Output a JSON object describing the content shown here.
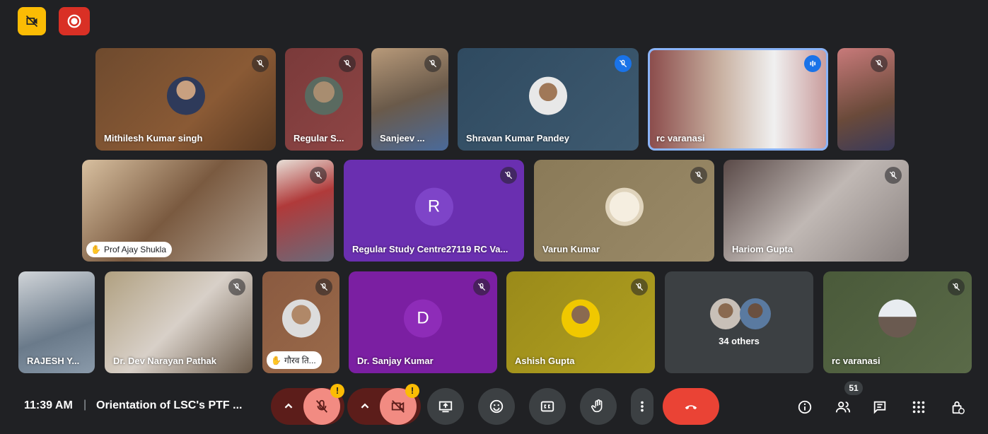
{
  "top_badges": {
    "recording_icon": "record-icon",
    "no_camera_icon": "camera-off-icon"
  },
  "participants_row1": [
    {
      "name": "Mithilesh Kumar singh",
      "muted": true
    },
    {
      "name": "Regular S...",
      "muted": true
    },
    {
      "name": "Sanjeev ...",
      "muted": true
    },
    {
      "name": "Shravan Kumar Pandey",
      "muted": true
    },
    {
      "name": "rc varanasi",
      "speaking": true
    },
    {
      "name": "",
      "muted": true
    }
  ],
  "participants_row2": [
    {
      "name": "Prof Ajay Shukla",
      "hand_raised": true
    },
    {
      "name": "",
      "muted": true
    },
    {
      "name": "Regular Study Centre27119 RC Va...",
      "initial": "R",
      "muted": true
    },
    {
      "name": "Varun Kumar",
      "muted": true
    },
    {
      "name": "Hariom Gupta",
      "muted": true
    }
  ],
  "participants_row3": [
    {
      "name": "RAJESH Y..."
    },
    {
      "name": "Dr. Dev Narayan Pathak",
      "muted": true
    },
    {
      "name": "गौरव ति...",
      "hand_raised": true,
      "muted": true
    },
    {
      "name": "Dr. Sanjay Kumar",
      "initial": "D",
      "muted": true
    },
    {
      "name": "Ashish Gupta",
      "muted": true
    },
    {
      "name": "34 others"
    },
    {
      "name": "rc varanasi",
      "muted": true
    }
  ],
  "footer": {
    "time": "11:39 AM",
    "separator": "|",
    "meeting_title": "Orientation of LSC's PTF ...",
    "participant_count": "51",
    "alert_mark": "!"
  },
  "colors": {
    "end_call": "#ea4335",
    "mic_off_bg": "#f28b82",
    "chevron_bg": "#5c1d1a",
    "badge_yellow": "#fbbc04",
    "record_red": "#d93025"
  }
}
